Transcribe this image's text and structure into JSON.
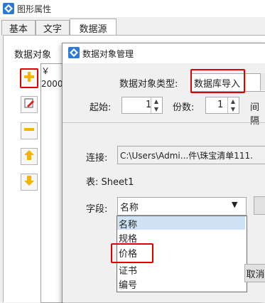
{
  "window": {
    "title": "图形属性"
  },
  "tabs": [
    {
      "label": "基本"
    },
    {
      "label": "文字"
    },
    {
      "label": "数据源"
    }
  ],
  "left": {
    "label": "数据对象",
    "list": [
      "￥",
      "2000"
    ]
  },
  "dialog": {
    "title": "数据对象管理",
    "type_label": "数据对象类型:",
    "type_value": "数据库导入",
    "start_label": "起始:",
    "start_value": "1",
    "copies_label": "份数:",
    "copies_value": "1",
    "interval_label": "间隔",
    "conn_label": "连接:",
    "conn_value": "C:\\Users\\Admi...件\\珠宝清单111.",
    "table_text": "表: Sheet1",
    "field_label": "字段:",
    "field_value": "名称",
    "field_options": [
      "名称",
      "规格",
      "价格",
      "证书",
      "编号"
    ],
    "cancel_label": "取消"
  },
  "colors": {
    "highlight": "#e00000",
    "selected": "#cfe2f6",
    "accent_yellow": "#f5b400"
  }
}
